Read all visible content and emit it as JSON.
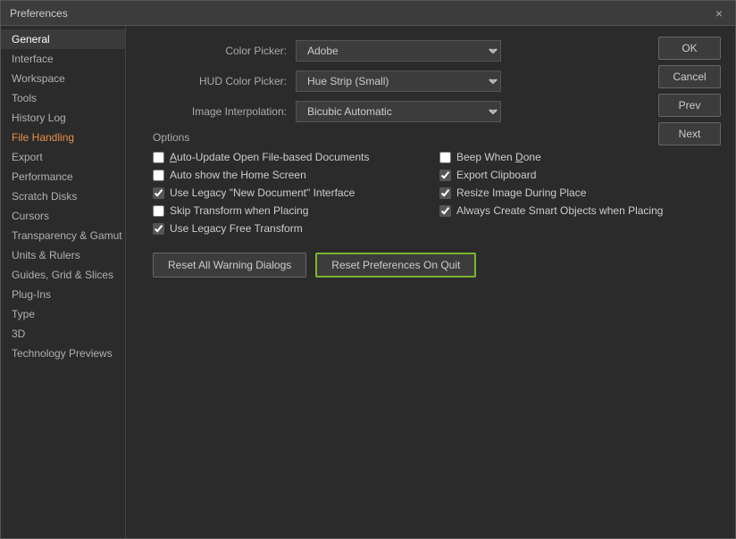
{
  "dialog": {
    "title": "Preferences",
    "close_icon": "×"
  },
  "sidebar": {
    "items": [
      {
        "label": "General",
        "active": true
      },
      {
        "label": "Interface",
        "active": false
      },
      {
        "label": "Workspace",
        "active": false
      },
      {
        "label": "Tools",
        "active": false
      },
      {
        "label": "History Log",
        "active": false
      },
      {
        "label": "File Handling",
        "active": false,
        "orange": true
      },
      {
        "label": "Export",
        "active": false
      },
      {
        "label": "Performance",
        "active": false
      },
      {
        "label": "Scratch Disks",
        "active": false
      },
      {
        "label": "Cursors",
        "active": false
      },
      {
        "label": "Transparency & Gamut",
        "active": false
      },
      {
        "label": "Units & Rulers",
        "active": false
      },
      {
        "label": "Guides, Grid & Slices",
        "active": false
      },
      {
        "label": "Plug-Ins",
        "active": false
      },
      {
        "label": "Type",
        "active": false
      },
      {
        "label": "3D",
        "active": false
      },
      {
        "label": "Technology Previews",
        "active": false
      }
    ]
  },
  "fields": {
    "color_picker_label": "Color Picker:",
    "color_picker_value": "Adobe",
    "hud_color_picker_label": "HUD Color Picker:",
    "hud_color_picker_value": "Hue Strip (Small)",
    "image_interpolation_label": "Image Interpolation:",
    "image_interpolation_value": "Bicubic Automatic"
  },
  "options": {
    "section_label": "Options",
    "checkboxes": [
      {
        "label": "Auto-Update Open File-based Documents",
        "checked": false,
        "underline_char": "A",
        "col": 0
      },
      {
        "label": "Beep When Done",
        "checked": false,
        "underline_char": "D",
        "col": 1
      },
      {
        "label": "Auto show the Home Screen",
        "checked": false,
        "underline_char": "",
        "col": 0
      },
      {
        "label": "Export Clipboard",
        "checked": true,
        "underline_char": "",
        "col": 1
      },
      {
        "label": "Use Legacy \"New Document\" Interface",
        "checked": true,
        "underline_char": "",
        "col": 0
      },
      {
        "label": "Resize Image During Place",
        "checked": true,
        "underline_char": "",
        "col": 1
      },
      {
        "label": "Skip Transform when Placing",
        "checked": false,
        "underline_char": "",
        "col": 0
      },
      {
        "label": "Always Create Smart Objects when Placing",
        "checked": true,
        "underline_char": "",
        "col": 1
      },
      {
        "label": "Use Legacy Free Transform",
        "checked": true,
        "underline_char": "",
        "col": 0
      }
    ]
  },
  "buttons": {
    "reset_warnings": "Reset All Warning Dialogs",
    "reset_prefs": "Reset Preferences On Quit",
    "ok": "OK",
    "cancel": "Cancel",
    "prev": "Prev",
    "next": "Next"
  }
}
